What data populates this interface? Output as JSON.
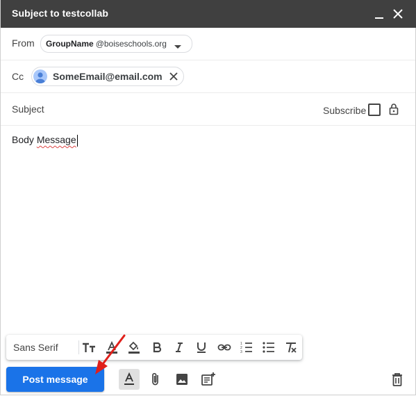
{
  "window": {
    "title": "Subject to testcollab"
  },
  "from": {
    "label": "From",
    "group_name": "GroupName",
    "domain": "@boiseschools.org"
  },
  "cc": {
    "label": "Cc",
    "recipient": "SomeEmail@email.com"
  },
  "subject": {
    "label": "Subject",
    "subscribe_label": "Subscribe"
  },
  "body": {
    "prefix": "Body ",
    "squiggle": "Message"
  },
  "formatting": {
    "font": "Sans Serif"
  },
  "actions": {
    "post_label": "Post message"
  },
  "colors": {
    "titlebar": "#404040",
    "primary": "#1a73e8",
    "annotation_arrow": "#e0201b"
  }
}
